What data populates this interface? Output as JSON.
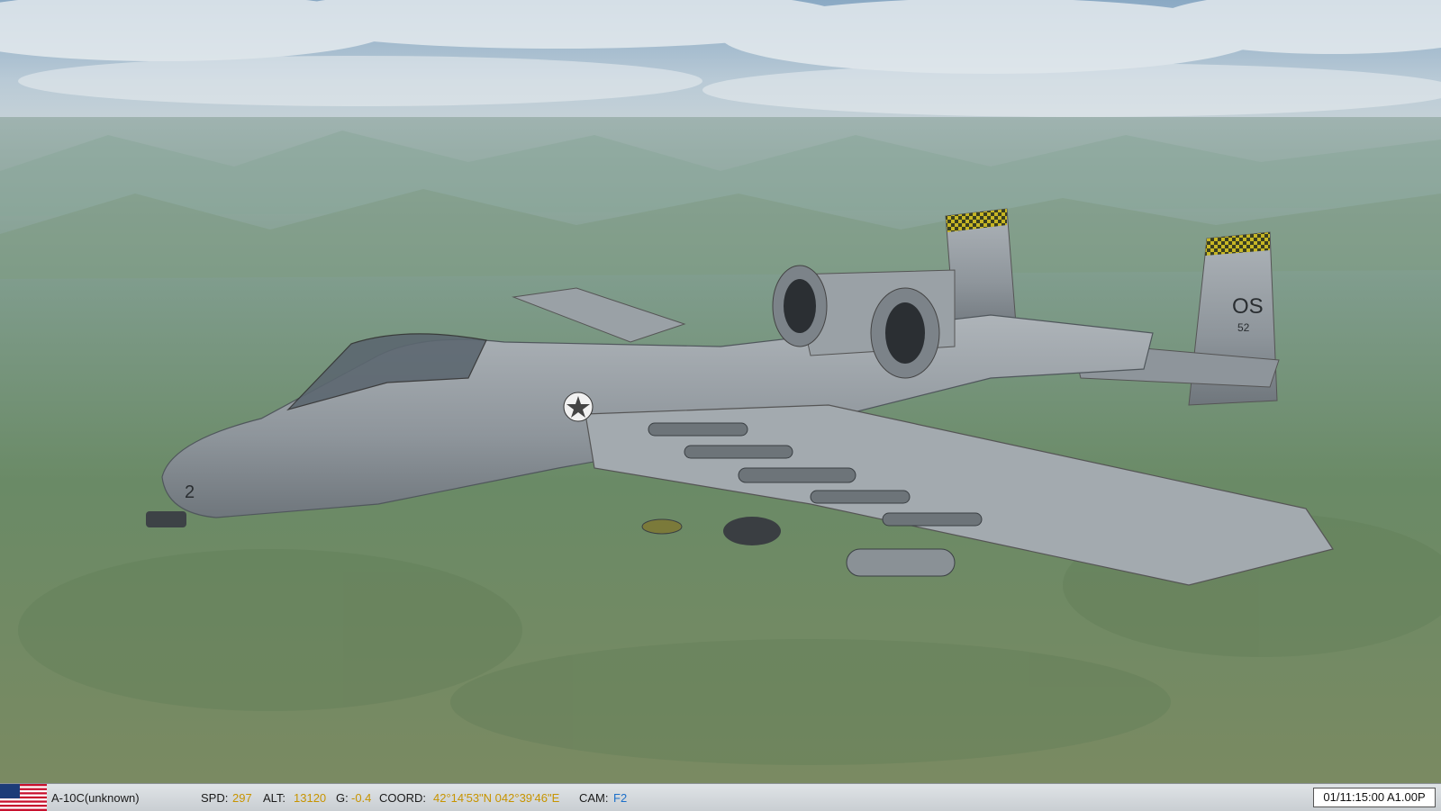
{
  "scene": {
    "description_icon": "aircraft-external-view",
    "sky_color": "#9fb6c8",
    "terrain_color": "#6b8a66",
    "tail_codes": [
      "OS",
      "52"
    ],
    "nose_number": "2",
    "colors": {
      "airframe": "#8e959b",
      "tail_checker": "#c7b624"
    }
  },
  "status": {
    "flag_icon": "us-flag-icon",
    "unit": "A-10C(unknown)",
    "spd_label": "SPD:",
    "spd_value": "297",
    "alt_label": "ALT:",
    "alt_value": "13120",
    "g_label": "G:",
    "g_value": "-0.4",
    "coord_label": "COORD:",
    "coord_value": "42°14'53\"N 042°39'46\"E",
    "cam_label": "CAM:",
    "cam_value": "F2",
    "time": "01/11:15:00 A1.00P"
  }
}
